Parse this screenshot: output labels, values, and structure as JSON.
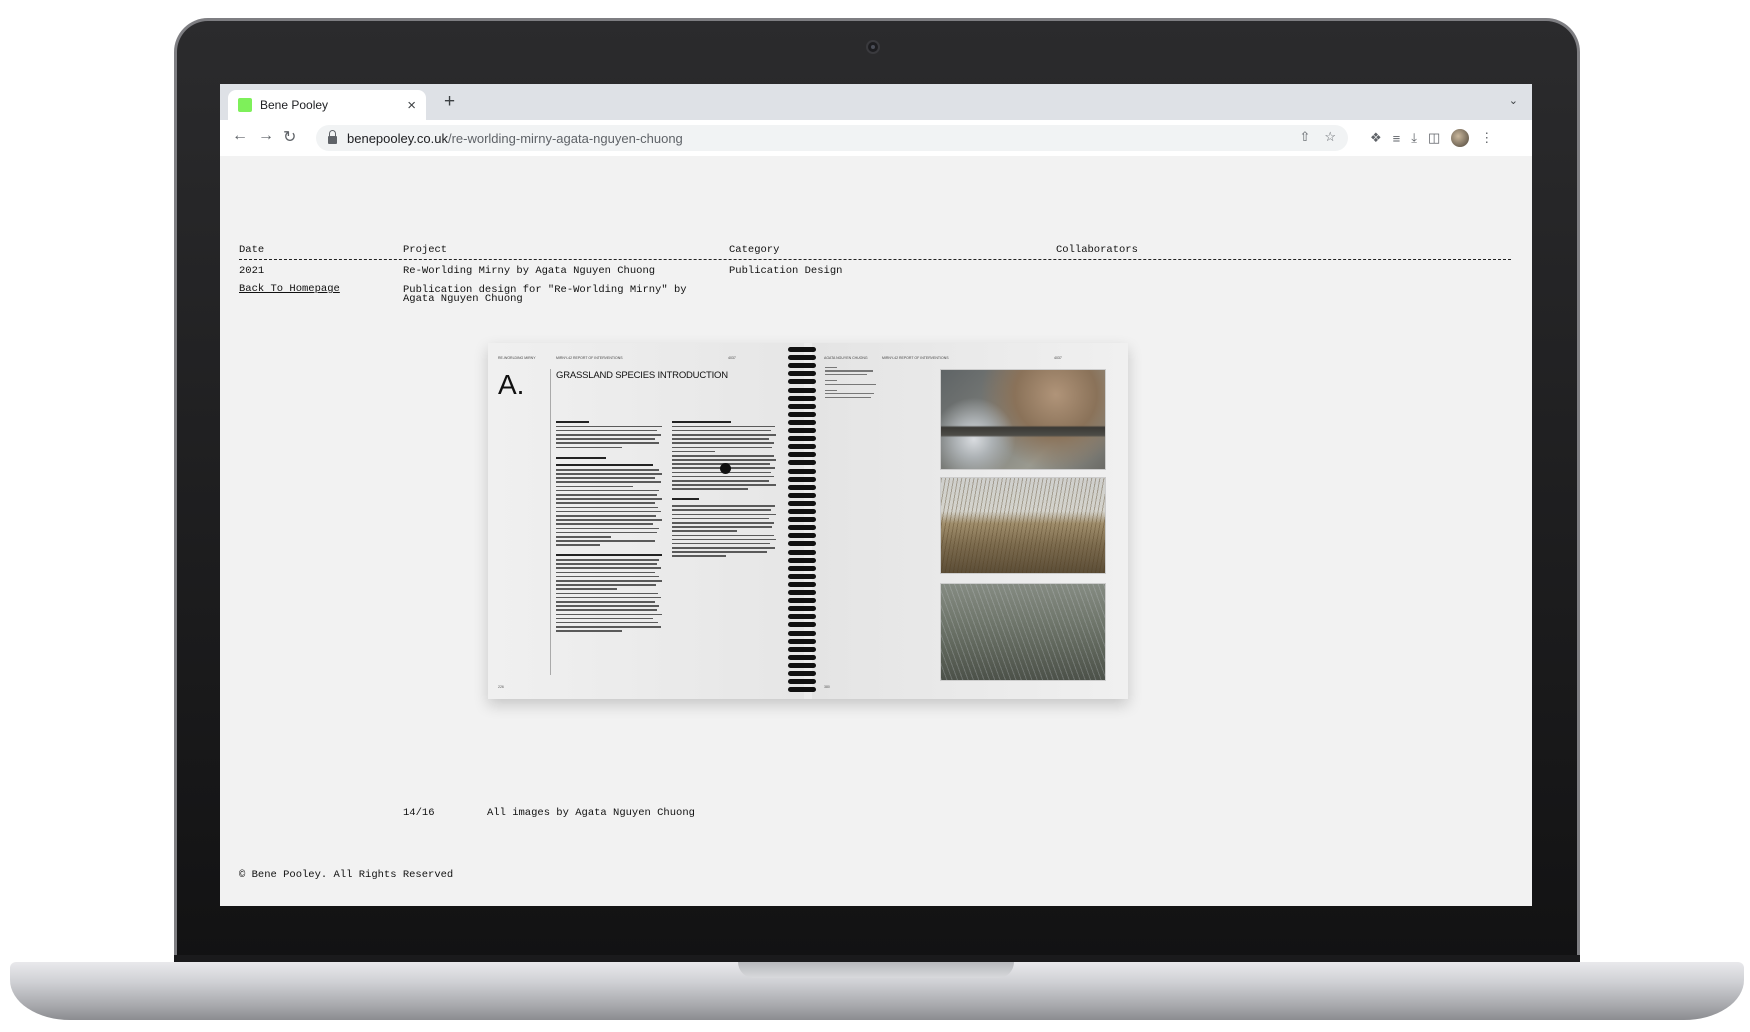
{
  "browser": {
    "tab_title": "Bene Pooley",
    "tab_close": "×",
    "new_tab": "+",
    "tab_menu": "⌄",
    "url_domain": "benepooley.co.uk",
    "url_path": "/re-worlding-mirny-agata-nguyen-chuong"
  },
  "page": {
    "headers": {
      "date": "Date",
      "project": "Project",
      "category": "Category",
      "collaborators": "Collaborators"
    },
    "date_value": "2021",
    "project_value": "Re-Worlding Mirny by Agata Nguyen Chuong",
    "category_value": "Publication Design",
    "back_link": "Back To Homepage",
    "description_line1": "Publication design for \"Re-Worlding Mirny\" by",
    "description_line2": "Agata Nguyen Chuong",
    "counter": "14/16",
    "credit": "All images by Agata Nguyen Chuong",
    "footer": "© Bene Pooley. All Rights Reserved"
  },
  "spread": {
    "section_letter": "A.",
    "section_title": "GRASSLAND SPECIES INTRODUCTION"
  }
}
